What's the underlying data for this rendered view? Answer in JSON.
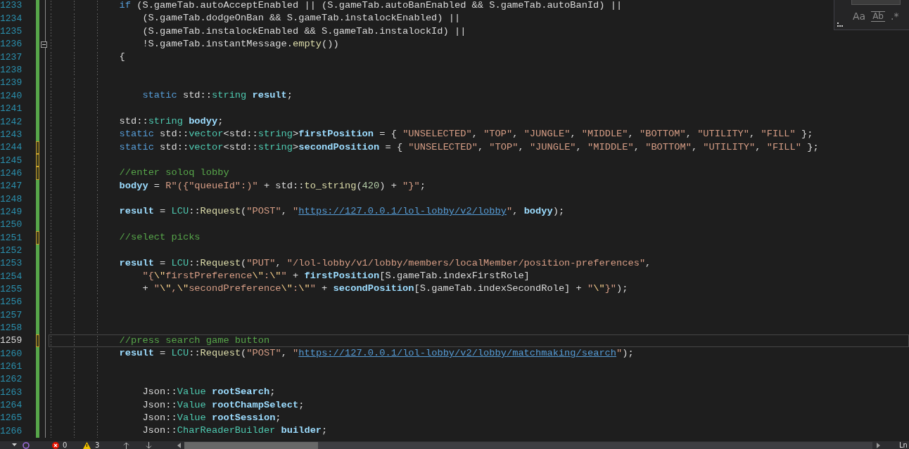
{
  "editor": {
    "lines": [
      {
        "number": "1233",
        "saved": true,
        "selected": false,
        "foldable": false,
        "indented": false,
        "tokens": [
          {
            "kind": "kw",
            "text": "if"
          },
          {
            "kind": "pl",
            "text": " (S.gameTab.autoAcceptEnabled || (S.gameTab.autoBanEnabled && S.gameTab.autoBanId) ||"
          }
        ]
      },
      {
        "number": "1234",
        "saved": true,
        "selected": false,
        "foldable": false,
        "indented": true,
        "tokens": [
          {
            "kind": "pl",
            "text": "(S.gameTab.dodgeOnBan && S.gameTab.instalockEnabled) ||"
          }
        ]
      },
      {
        "number": "1235",
        "saved": true,
        "selected": false,
        "foldable": false,
        "indented": true,
        "tokens": [
          {
            "kind": "pl",
            "text": "(S.gameTab.instalockEnabled && S.gameTab.instalockId) ||"
          }
        ]
      },
      {
        "number": "1236",
        "saved": true,
        "selected": false,
        "foldable": true,
        "indented": true,
        "tokens": [
          {
            "kind": "pl",
            "text": "!S.gameTab.instantMessage."
          },
          {
            "kind": "fn",
            "text": "empty"
          },
          {
            "kind": "pl",
            "text": "())"
          }
        ]
      },
      {
        "number": "1237",
        "saved": true,
        "selected": false,
        "foldable": false,
        "indented": false,
        "tokens": [
          {
            "kind": "pl",
            "text": "{"
          }
        ]
      },
      {
        "number": "1238",
        "saved": true,
        "selected": false,
        "foldable": false
      },
      {
        "number": "1239",
        "saved": true,
        "selected": false,
        "foldable": false
      },
      {
        "number": "1240",
        "saved": true,
        "selected": false,
        "foldable": false,
        "indented": true,
        "tokens": [
          {
            "kind": "kw",
            "text": "static"
          },
          {
            "kind": "pl",
            "text": " std::"
          },
          {
            "kind": "ty",
            "text": "string "
          },
          {
            "kind": "va",
            "text": "result"
          },
          {
            "kind": "pl",
            "text": ";"
          }
        ]
      },
      {
        "number": "1241",
        "saved": true,
        "selected": false,
        "foldable": false
      },
      {
        "number": "1242",
        "saved": true,
        "selected": false,
        "foldable": false,
        "indented": false,
        "tokens": [
          {
            "kind": "pl",
            "text": "std::"
          },
          {
            "kind": "ty",
            "text": "string "
          },
          {
            "kind": "va",
            "text": "bodyy"
          },
          {
            "kind": "pl",
            "text": ";"
          }
        ]
      },
      {
        "number": "1243",
        "saved": true,
        "selected": false,
        "foldable": false,
        "indented": false,
        "tokens": [
          {
            "kind": "kw",
            "text": "static"
          },
          {
            "kind": "pl",
            "text": " std::"
          },
          {
            "kind": "ty",
            "text": "vector"
          },
          {
            "kind": "pl",
            "text": "<std::"
          },
          {
            "kind": "ty",
            "text": "string"
          },
          {
            "kind": "pl",
            "text": ">"
          },
          {
            "kind": "va",
            "text": "firstPosition"
          },
          {
            "kind": "pl",
            "text": " = { "
          },
          {
            "kind": "st",
            "text": "\"UNSELECTED\""
          },
          {
            "kind": "pl",
            "text": ", "
          },
          {
            "kind": "st",
            "text": "\"TOP\""
          },
          {
            "kind": "pl",
            "text": ", "
          },
          {
            "kind": "st",
            "text": "\"JUNGLE\""
          },
          {
            "kind": "pl",
            "text": ", "
          },
          {
            "kind": "st",
            "text": "\"MIDDLE\""
          },
          {
            "kind": "pl",
            "text": ", "
          },
          {
            "kind": "st",
            "text": "\"BOTTOM\""
          },
          {
            "kind": "pl",
            "text": ", "
          },
          {
            "kind": "st",
            "text": "\"UTILITY\""
          },
          {
            "kind": "pl",
            "text": ", "
          },
          {
            "kind": "st",
            "text": "\"FILL\""
          },
          {
            "kind": "pl",
            "text": " };"
          }
        ]
      },
      {
        "number": "1244",
        "saved": false,
        "selected": false,
        "foldable": false,
        "indented": false,
        "tokens": [
          {
            "kind": "kw",
            "text": "static"
          },
          {
            "kind": "pl",
            "text": " std::"
          },
          {
            "kind": "ty",
            "text": "vector"
          },
          {
            "kind": "pl",
            "text": "<std::"
          },
          {
            "kind": "ty",
            "text": "string"
          },
          {
            "kind": "pl",
            "text": ">"
          },
          {
            "kind": "va",
            "text": "secondPosition"
          },
          {
            "kind": "pl",
            "text": " = { "
          },
          {
            "kind": "st",
            "text": "\"UNSELECTED\""
          },
          {
            "kind": "pl",
            "text": ", "
          },
          {
            "kind": "st",
            "text": "\"TOP\""
          },
          {
            "kind": "pl",
            "text": ", "
          },
          {
            "kind": "st",
            "text": "\"JUNGLE\""
          },
          {
            "kind": "pl",
            "text": ", "
          },
          {
            "kind": "st",
            "text": "\"MIDDLE\""
          },
          {
            "kind": "pl",
            "text": ", "
          },
          {
            "kind": "st",
            "text": "\"BOTTOM\""
          },
          {
            "kind": "pl",
            "text": ", "
          },
          {
            "kind": "st",
            "text": "\"UTILITY\""
          },
          {
            "kind": "pl",
            "text": ", "
          },
          {
            "kind": "st",
            "text": "\"FILL\""
          },
          {
            "kind": "pl",
            "text": " };"
          }
        ]
      },
      {
        "number": "1245",
        "saved": false,
        "selected": false,
        "foldable": false
      },
      {
        "number": "1246",
        "saved": false,
        "selected": false,
        "foldable": false,
        "indented": false,
        "tokens": [
          {
            "kind": "cm",
            "text": "//enter soloq lobby"
          }
        ]
      },
      {
        "number": "1247",
        "saved": true,
        "selected": false,
        "foldable": false,
        "indented": false,
        "tokens": [
          {
            "kind": "va",
            "text": "bodyy"
          },
          {
            "kind": "pl",
            "text": " = "
          },
          {
            "kind": "st",
            "text": "R\"({\"queueId\":)\""
          },
          {
            "kind": "pl",
            "text": " + std::"
          },
          {
            "kind": "fn",
            "text": "to_string"
          },
          {
            "kind": "pl",
            "text": "("
          },
          {
            "kind": "nu",
            "text": "420"
          },
          {
            "kind": "pl",
            "text": ") + "
          },
          {
            "kind": "st",
            "text": "\"}\""
          },
          {
            "kind": "pl",
            "text": ";"
          }
        ]
      },
      {
        "number": "1248",
        "saved": true,
        "selected": false,
        "foldable": false
      },
      {
        "number": "1249",
        "saved": true,
        "selected": false,
        "foldable": false,
        "indented": false,
        "tokens": [
          {
            "kind": "va",
            "text": "result"
          },
          {
            "kind": "pl",
            "text": " = "
          },
          {
            "kind": "ty",
            "text": "LCU"
          },
          {
            "kind": "pl",
            "text": "::"
          },
          {
            "kind": "fn",
            "text": "Request"
          },
          {
            "kind": "pl",
            "text": "("
          },
          {
            "kind": "st",
            "text": "\"POST\""
          },
          {
            "kind": "pl",
            "text": ", "
          },
          {
            "kind": "st",
            "text": "\""
          },
          {
            "kind": "ln",
            "text": "https://127.0.0.1/lol-lobby/v2/lobby"
          },
          {
            "kind": "st",
            "text": "\""
          },
          {
            "kind": "pl",
            "text": ", "
          },
          {
            "kind": "va",
            "text": "bodyy"
          },
          {
            "kind": "pl",
            "text": ");"
          }
        ]
      },
      {
        "number": "1250",
        "saved": true,
        "selected": false,
        "foldable": false
      },
      {
        "number": "1251",
        "saved": false,
        "selected": false,
        "foldable": false,
        "indented": false,
        "tokens": [
          {
            "kind": "cm",
            "text": "//select picks"
          }
        ]
      },
      {
        "number": "1252",
        "saved": true,
        "selected": false,
        "foldable": false
      },
      {
        "number": "1253",
        "saved": true,
        "selected": false,
        "foldable": false,
        "indented": false,
        "tokens": [
          {
            "kind": "va",
            "text": "result"
          },
          {
            "kind": "pl",
            "text": " = "
          },
          {
            "kind": "ty",
            "text": "LCU"
          },
          {
            "kind": "pl",
            "text": "::"
          },
          {
            "kind": "fn",
            "text": "Request"
          },
          {
            "kind": "pl",
            "text": "("
          },
          {
            "kind": "st",
            "text": "\"PUT\""
          },
          {
            "kind": "pl",
            "text": ", "
          },
          {
            "kind": "st",
            "text": "\"/lol-lobby/v1/lobby/members/localMember/position-preferences\""
          },
          {
            "kind": "pl",
            "text": ","
          }
        ]
      },
      {
        "number": "1254",
        "saved": true,
        "selected": false,
        "foldable": false,
        "indented": true,
        "tokens": [
          {
            "kind": "st",
            "text": "\"{"
          },
          {
            "kind": "es",
            "text": "\\\""
          },
          {
            "kind": "st",
            "text": "firstPreference"
          },
          {
            "kind": "es",
            "text": "\\\""
          },
          {
            "kind": "st",
            "text": ":"
          },
          {
            "kind": "es",
            "text": "\\\""
          },
          {
            "kind": "st",
            "text": "\""
          },
          {
            "kind": "pl",
            "text": " + "
          },
          {
            "kind": "va",
            "text": "firstPosition"
          },
          {
            "kind": "pl",
            "text": "[S.gameTab.indexFirstRole]"
          }
        ]
      },
      {
        "number": "1255",
        "saved": true,
        "selected": false,
        "foldable": false,
        "indented": true,
        "tokens": [
          {
            "kind": "pl",
            "text": "+ "
          },
          {
            "kind": "st",
            "text": "\""
          },
          {
            "kind": "es",
            "text": "\\\""
          },
          {
            "kind": "st",
            "text": ","
          },
          {
            "kind": "es",
            "text": "\\\""
          },
          {
            "kind": "st",
            "text": "secondPreference"
          },
          {
            "kind": "es",
            "text": "\\\""
          },
          {
            "kind": "st",
            "text": ":"
          },
          {
            "kind": "es",
            "text": "\\\""
          },
          {
            "kind": "st",
            "text": "\""
          },
          {
            "kind": "pl",
            "text": " + "
          },
          {
            "kind": "va",
            "text": "secondPosition"
          },
          {
            "kind": "pl",
            "text": "[S.gameTab.indexSecondRole] + "
          },
          {
            "kind": "st",
            "text": "\""
          },
          {
            "kind": "es",
            "text": "\\\""
          },
          {
            "kind": "st",
            "text": "}\""
          },
          {
            "kind": "pl",
            "text": ");"
          }
        ]
      },
      {
        "number": "1256",
        "saved": true,
        "selected": false,
        "foldable": false
      },
      {
        "number": "1257",
        "saved": true,
        "selected": false,
        "foldable": false
      },
      {
        "number": "1258",
        "saved": true,
        "selected": false,
        "foldable": false
      },
      {
        "number": "1259",
        "saved": false,
        "selected": true,
        "foldable": false,
        "indented": false,
        "tokens": [
          {
            "kind": "cm",
            "text": "//press search game button"
          }
        ]
      },
      {
        "number": "1260",
        "saved": true,
        "selected": false,
        "foldable": false,
        "indented": false,
        "tokens": [
          {
            "kind": "va",
            "text": "result"
          },
          {
            "kind": "pl",
            "text": " = "
          },
          {
            "kind": "ty",
            "text": "LCU"
          },
          {
            "kind": "pl",
            "text": "::"
          },
          {
            "kind": "fn",
            "text": "Request"
          },
          {
            "kind": "pl",
            "text": "("
          },
          {
            "kind": "st",
            "text": "\"POST\""
          },
          {
            "kind": "pl",
            "text": ", "
          },
          {
            "kind": "st",
            "text": "\""
          },
          {
            "kind": "ln",
            "text": "https://127.0.0.1/lol-lobby/v2/lobby/matchmaking/search"
          },
          {
            "kind": "st",
            "text": "\""
          },
          {
            "kind": "pl",
            "text": ");"
          }
        ]
      },
      {
        "number": "1261",
        "saved": true,
        "selected": false,
        "foldable": false
      },
      {
        "number": "1262",
        "saved": true,
        "selected": false,
        "foldable": false
      },
      {
        "number": "1263",
        "saved": true,
        "selected": false,
        "foldable": false,
        "indented": true,
        "tokens": [
          {
            "kind": "pl",
            "text": "Json::"
          },
          {
            "kind": "ty",
            "text": "Value "
          },
          {
            "kind": "va",
            "text": "rootSearch"
          },
          {
            "kind": "pl",
            "text": ";"
          }
        ]
      },
      {
        "number": "1264",
        "saved": true,
        "selected": false,
        "foldable": false,
        "indented": true,
        "tokens": [
          {
            "kind": "pl",
            "text": "Json::"
          },
          {
            "kind": "ty",
            "text": "Value "
          },
          {
            "kind": "va",
            "text": "rootChampSelect"
          },
          {
            "kind": "pl",
            "text": ";"
          }
        ]
      },
      {
        "number": "1265",
        "saved": true,
        "selected": false,
        "foldable": false,
        "indented": true,
        "tokens": [
          {
            "kind": "pl",
            "text": "Json::"
          },
          {
            "kind": "ty",
            "text": "Value "
          },
          {
            "kind": "va",
            "text": "rootSession"
          },
          {
            "kind": "pl",
            "text": ";"
          }
        ]
      },
      {
        "number": "1266",
        "saved": true,
        "selected": false,
        "foldable": false,
        "indented": true,
        "tokens": [
          {
            "kind": "pl",
            "text": "Json::"
          },
          {
            "kind": "ty",
            "text": "CharReaderBuilder "
          },
          {
            "kind": "va",
            "text": "builder"
          },
          {
            "kind": "pl",
            "text": ";"
          }
        ]
      }
    ]
  },
  "find_widget": {
    "options": [
      {
        "label": "Aa",
        "kind": "text"
      },
      {
        "label": "Ab",
        "kind": "boxed"
      },
      {
        "label": ".*",
        "kind": "text"
      }
    ]
  },
  "status_bar": {
    "errors": "0",
    "warnings": "3",
    "position_label": "Ln"
  }
}
